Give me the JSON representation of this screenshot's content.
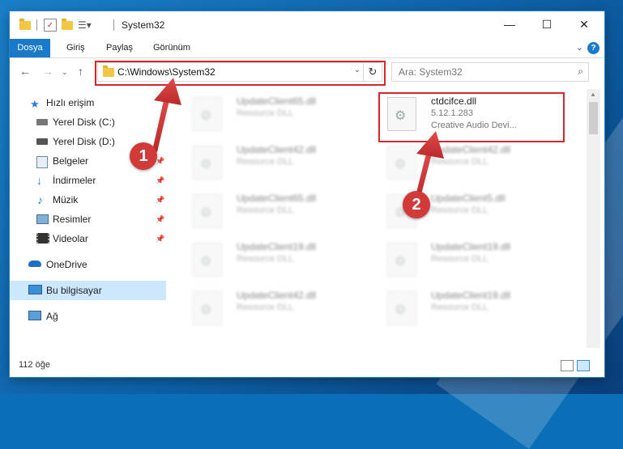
{
  "window": {
    "title": "System32"
  },
  "ribbon": {
    "tabs": [
      "Dosya",
      "Giriş",
      "Paylaş",
      "Görünüm"
    ]
  },
  "nav": {
    "address": "C:\\Windows\\System32",
    "search_placeholder": "Ara: System32"
  },
  "sidebar": {
    "items": [
      {
        "label": "Hızlı erişim",
        "icon": "star-icon"
      },
      {
        "label": "Yerel Disk (C:)",
        "icon": "drive-icon"
      },
      {
        "label": "Yerel Disk (D:)",
        "icon": "drive-icon"
      },
      {
        "label": "Belgeler",
        "icon": "documents-icon"
      },
      {
        "label": "İndirmeler",
        "icon": "download-icon"
      },
      {
        "label": "Müzik",
        "icon": "music-icon"
      },
      {
        "label": "Resimler",
        "icon": "pictures-icon"
      },
      {
        "label": "Videolar",
        "icon": "video-icon"
      },
      {
        "label": "OneDrive",
        "icon": "cloud-icon"
      },
      {
        "label": "Bu bilgisayar",
        "icon": "computer-icon"
      },
      {
        "label": "Ağ",
        "icon": "network-icon"
      }
    ]
  },
  "files": [
    {
      "name": "UpdateClient65.dll",
      "type": "Resource DLL"
    },
    {
      "name": "ctdcifce.dll",
      "version": "5.12.1.283",
      "description": "Creative Audio Devi..."
    },
    {
      "name": "UpdateClient42.dll",
      "type": "Resource DLL"
    },
    {
      "name": "UpdateClient42.dll",
      "type": "Resource DLL"
    },
    {
      "name": "UpdateClient65.dll",
      "type": "Resource DLL"
    },
    {
      "name": "UpdateClient5.dll",
      "type": "Resource DLL"
    },
    {
      "name": "UpdateClient19.dll",
      "type": "Resource DLL"
    },
    {
      "name": "UpdateClient19.dll",
      "type": "Resource DLL"
    },
    {
      "name": "UpdateClient42.dll",
      "type": "Resource DLL"
    },
    {
      "name": "UpdateClient19.dll",
      "type": "Resource DLL"
    }
  ],
  "status": {
    "item_count": "112 öğe"
  },
  "annotations": {
    "step1": "1",
    "step2": "2"
  },
  "colors": {
    "accent": "#1979ca",
    "highlight": "#d9262c",
    "badge": "#d23a3a",
    "selected": "#cce8ff"
  }
}
